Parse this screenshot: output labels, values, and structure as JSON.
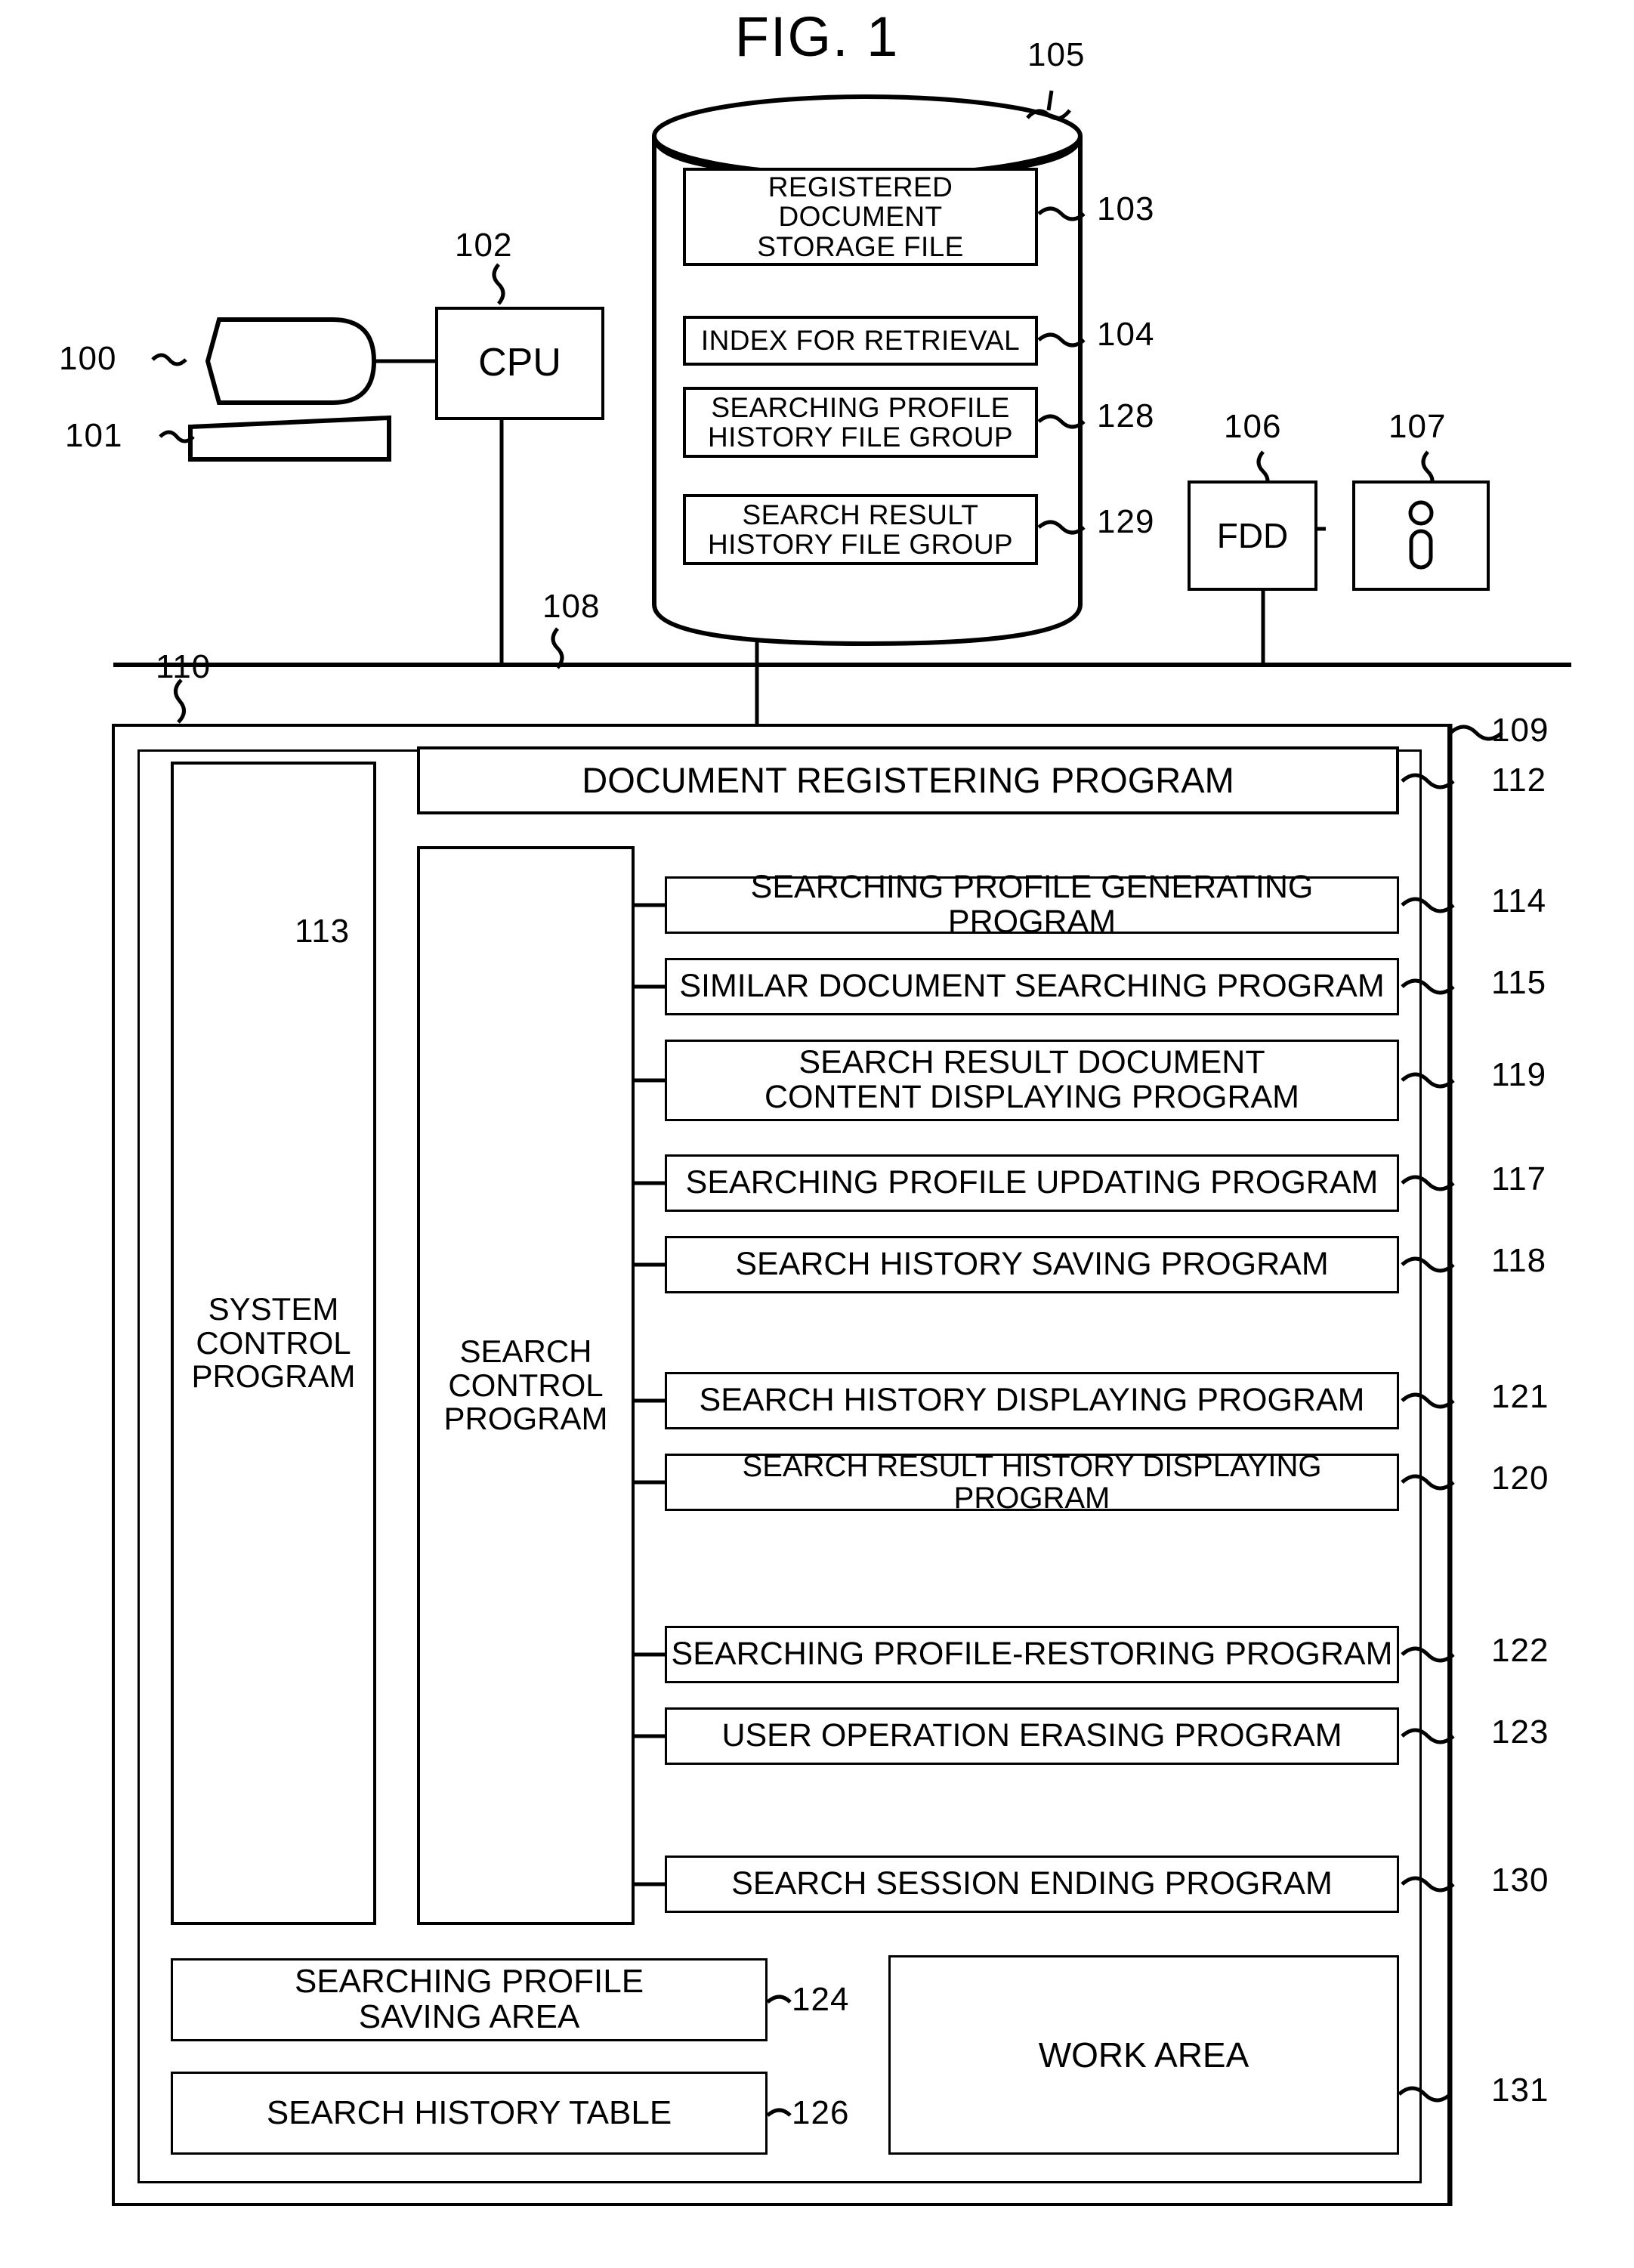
{
  "figure": {
    "title": "FIG. 1"
  },
  "nodes": {
    "terminal": {
      "ref": "100",
      "label": ""
    },
    "keyboard": {
      "ref": "101",
      "label": ""
    },
    "cpu": {
      "ref": "102",
      "label": "CPU"
    },
    "storage_unit": {
      "ref": "105",
      "label": ""
    },
    "fdd": {
      "ref": "106",
      "label": "FDD"
    },
    "floppy": {
      "ref": "107",
      "label": ""
    },
    "bus": {
      "ref": "108",
      "label": ""
    },
    "memory": {
      "ref": "109",
      "label": ""
    },
    "memory_inner": {
      "ref": "110",
      "label": ""
    }
  },
  "storage_files": [
    {
      "ref": "103",
      "label": "REGISTERED\nDOCUMENT\nSTORAGE  FILE"
    },
    {
      "ref": "104",
      "label": "INDEX FOR RETRIEVAL"
    },
    {
      "ref": "128",
      "label": "SEARCHING PROFILE\nHISTORY FILE GROUP"
    },
    {
      "ref": "129",
      "label": "SEARCH RESULT\nHISTORY FILE GROUP"
    }
  ],
  "control_programs": [
    {
      "ref": "",
      "label": "SYSTEM\nCONTROL\nPROGRAM"
    },
    {
      "ref": "113",
      "label": "SEARCH\nCONTROL\nPROGRAM"
    }
  ],
  "programs": [
    {
      "ref": "112",
      "label": "DOCUMENT REGISTERING PROGRAM"
    },
    {
      "ref": "114",
      "label": "SEARCHING PROFILE GENERATING PROGRAM"
    },
    {
      "ref": "115",
      "label": "SIMILAR DOCUMENT SEARCHING PROGRAM"
    },
    {
      "ref": "119",
      "label": "SEARCH RESULT DOCUMENT\nCONTENT DISPLAYING PROGRAM"
    },
    {
      "ref": "117",
      "label": "SEARCHING PROFILE UPDATING PROGRAM"
    },
    {
      "ref": "118",
      "label": "SEARCH HISTORY SAVING PROGRAM"
    },
    {
      "ref": "121",
      "label": "SEARCH HISTORY DISPLAYING PROGRAM"
    },
    {
      "ref": "120",
      "label": "SEARCH RESULT HISTORY DISPLAYING PROGRAM"
    },
    {
      "ref": "122",
      "label": "SEARCHING PROFILE-RESTORING PROGRAM"
    },
    {
      "ref": "123",
      "label": "USER OPERATION ERASING PROGRAM"
    },
    {
      "ref": "130",
      "label": "SEARCH SESSION ENDING PROGRAM"
    }
  ],
  "memory_areas": [
    {
      "ref": "124",
      "label": "SEARCHING PROFILE\nSAVING AREA"
    },
    {
      "ref": "126",
      "label": "SEARCH HISTORY TABLE"
    },
    {
      "ref": "131",
      "label": "WORK AREA"
    }
  ]
}
